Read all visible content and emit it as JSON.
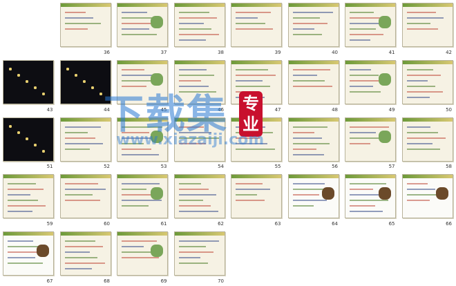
{
  "slide_numbers": [
    "36",
    "37",
    "38",
    "39",
    "40",
    "41",
    "42",
    "43",
    "44",
    "45",
    "46",
    "47",
    "48",
    "49",
    "50",
    "51",
    "52",
    "53",
    "54",
    "55",
    "56",
    "57",
    "58",
    "59",
    "60",
    "61",
    "62",
    "63",
    "64",
    "65",
    "66",
    "67",
    "68",
    "69",
    "70"
  ],
  "watermark": {
    "main": "下载集",
    "badge_top": "专",
    "badge_bottom": "业",
    "url": "www.xiazaiji.com"
  },
  "colors": {
    "accent": "#c04a3a",
    "watermark": "#2878d2",
    "badge": "#c8102e"
  }
}
